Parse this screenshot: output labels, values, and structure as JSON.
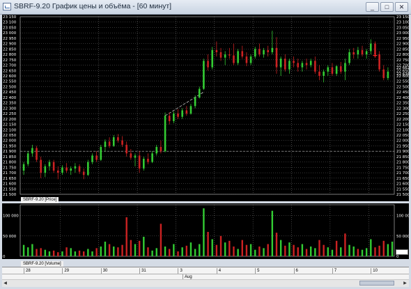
{
  "window": {
    "title": "SBRF-9.20 График цены и объёма - [60 минут]",
    "buttons": [
      "_",
      "□",
      "✕"
    ],
    "icon": "chart-icon"
  },
  "colors": {
    "background": "#000000",
    "up": "#33cc33",
    "down": "#cc2222",
    "grid": "#8a8a8a",
    "marker": "#ff2222"
  },
  "price_pane": {
    "label": "SBRF-9.20 [Price]",
    "y_ticks": [
      "23 150",
      "23 100",
      "23 050",
      "23 000",
      "22 950",
      "22 900",
      "22 850",
      "22 800",
      "22 750",
      "22 700",
      "22 650",
      "22 600",
      "22 550",
      "22 500",
      "22 450",
      "22 400",
      "22 350",
      "22 300",
      "22 250",
      "22 200",
      "22 150",
      "22 100",
      "22 050",
      "22 000",
      "21 950",
      "21 900",
      "21 850",
      "21 800",
      "21 750",
      "21 700",
      "21 650",
      "21 600",
      "21 550",
      "21 500"
    ],
    "right_highlight_labels": [
      "22 662",
      "22 638"
    ]
  },
  "volume_pane": {
    "label": "SBRF-9.20 [Volume]",
    "y_ticks": [
      "100 000",
      "50 000",
      "0"
    ]
  },
  "dates": [
    "28",
    "29",
    "30",
    "31",
    "3",
    "4",
    "5",
    "6",
    "7",
    "10"
  ],
  "month": "Aug",
  "chart_data": [
    {
      "type": "candlestick",
      "title": "SBRF-9.20 [Price]",
      "ylim": [
        21500,
        23150
      ],
      "horizontal_ref_line": 21900,
      "days": [
        "28",
        "29",
        "30",
        "31",
        "3",
        "4",
        "5",
        "6",
        "7",
        "10"
      ],
      "trend_line": {
        "from": [
          2230,
          22230
        ],
        "to": [
          2270,
          22450
        ]
      },
      "candles": [
        {
          "o": 21720,
          "h": 21800,
          "l": 21680,
          "c": 21780
        },
        {
          "o": 21780,
          "h": 21900,
          "l": 21760,
          "c": 21880
        },
        {
          "o": 21880,
          "h": 21960,
          "l": 21850,
          "c": 21930
        },
        {
          "o": 21930,
          "h": 21950,
          "l": 21800,
          "c": 21820
        },
        {
          "o": 21820,
          "h": 21850,
          "l": 21650,
          "c": 21700
        },
        {
          "o": 21700,
          "h": 21780,
          "l": 21660,
          "c": 21760
        },
        {
          "o": 21760,
          "h": 21820,
          "l": 21720,
          "c": 21800
        },
        {
          "o": 21800,
          "h": 21820,
          "l": 21700,
          "c": 21720
        },
        {
          "o": 21720,
          "h": 21760,
          "l": 21640,
          "c": 21700
        },
        {
          "o": 21700,
          "h": 21770,
          "l": 21680,
          "c": 21750
        },
        {
          "o": 21750,
          "h": 21790,
          "l": 21700,
          "c": 21720
        },
        {
          "o": 21720,
          "h": 21760,
          "l": 21680,
          "c": 21740
        },
        {
          "o": 21740,
          "h": 21790,
          "l": 21700,
          "c": 21760
        },
        {
          "o": 21760,
          "h": 21780,
          "l": 21690,
          "c": 21710
        },
        {
          "o": 21710,
          "h": 21740,
          "l": 21640,
          "c": 21680
        },
        {
          "o": 21680,
          "h": 21820,
          "l": 21670,
          "c": 21800
        },
        {
          "o": 21800,
          "h": 21880,
          "l": 21780,
          "c": 21860
        },
        {
          "o": 21860,
          "h": 21900,
          "l": 21800,
          "c": 21820
        },
        {
          "o": 21820,
          "h": 21960,
          "l": 21810,
          "c": 21940
        },
        {
          "o": 21940,
          "h": 22010,
          "l": 21900,
          "c": 21990
        },
        {
          "o": 21990,
          "h": 22030,
          "l": 21930,
          "c": 21950
        },
        {
          "o": 21950,
          "h": 22050,
          "l": 21940,
          "c": 22030
        },
        {
          "o": 22030,
          "h": 22060,
          "l": 21980,
          "c": 22000
        },
        {
          "o": 22000,
          "h": 22040,
          "l": 21940,
          "c": 21960
        },
        {
          "o": 21960,
          "h": 21990,
          "l": 21850,
          "c": 21880
        },
        {
          "o": 21880,
          "h": 21920,
          "l": 21820,
          "c": 21840
        },
        {
          "o": 21840,
          "h": 21880,
          "l": 21760,
          "c": 21860
        },
        {
          "o": 21860,
          "h": 21900,
          "l": 21700,
          "c": 21740
        },
        {
          "o": 21740,
          "h": 21850,
          "l": 21720,
          "c": 21830
        },
        {
          "o": 21830,
          "h": 21880,
          "l": 21780,
          "c": 21800
        },
        {
          "o": 21800,
          "h": 21900,
          "l": 21790,
          "c": 21880
        },
        {
          "o": 21880,
          "h": 21960,
          "l": 21860,
          "c": 21940
        },
        {
          "o": 21940,
          "h": 22000,
          "l": 21880,
          "c": 21900
        },
        {
          "o": 21900,
          "h": 22260,
          "l": 21890,
          "c": 22230
        },
        {
          "o": 22230,
          "h": 22260,
          "l": 22150,
          "c": 22180
        },
        {
          "o": 22180,
          "h": 22270,
          "l": 22160,
          "c": 22250
        },
        {
          "o": 22250,
          "h": 22290,
          "l": 22200,
          "c": 22220
        },
        {
          "o": 22220,
          "h": 22300,
          "l": 22200,
          "c": 22280
        },
        {
          "o": 22280,
          "h": 22320,
          "l": 22230,
          "c": 22250
        },
        {
          "o": 22250,
          "h": 22340,
          "l": 22240,
          "c": 22320
        },
        {
          "o": 22320,
          "h": 22420,
          "l": 22300,
          "c": 22400
        },
        {
          "o": 22400,
          "h": 22500,
          "l": 22390,
          "c": 22480
        },
        {
          "o": 22480,
          "h": 22760,
          "l": 22470,
          "c": 22740
        },
        {
          "o": 22740,
          "h": 22800,
          "l": 22650,
          "c": 22680
        },
        {
          "o": 22680,
          "h": 22870,
          "l": 22660,
          "c": 22840
        },
        {
          "o": 22840,
          "h": 22920,
          "l": 22780,
          "c": 22820
        },
        {
          "o": 22820,
          "h": 22860,
          "l": 22740,
          "c": 22770
        },
        {
          "o": 22770,
          "h": 22830,
          "l": 22700,
          "c": 22800
        },
        {
          "o": 22800,
          "h": 22860,
          "l": 22760,
          "c": 22790
        },
        {
          "o": 22790,
          "h": 22900,
          "l": 22700,
          "c": 22720
        },
        {
          "o": 22720,
          "h": 22850,
          "l": 22700,
          "c": 22830
        },
        {
          "o": 22830,
          "h": 22880,
          "l": 22760,
          "c": 22780
        },
        {
          "o": 22780,
          "h": 22820,
          "l": 22690,
          "c": 22720
        },
        {
          "o": 22720,
          "h": 22800,
          "l": 22700,
          "c": 22780
        },
        {
          "o": 22780,
          "h": 22870,
          "l": 22760,
          "c": 22850
        },
        {
          "o": 22850,
          "h": 22900,
          "l": 22780,
          "c": 22800
        },
        {
          "o": 22800,
          "h": 22860,
          "l": 22770,
          "c": 22840
        },
        {
          "o": 22840,
          "h": 22880,
          "l": 22780,
          "c": 22820
        },
        {
          "o": 22820,
          "h": 23020,
          "l": 22800,
          "c": 22860
        },
        {
          "o": 22860,
          "h": 22960,
          "l": 22620,
          "c": 22680
        },
        {
          "o": 22680,
          "h": 22780,
          "l": 22600,
          "c": 22760
        },
        {
          "o": 22760,
          "h": 22800,
          "l": 22640,
          "c": 22660
        },
        {
          "o": 22660,
          "h": 22760,
          "l": 22620,
          "c": 22740
        },
        {
          "o": 22740,
          "h": 22780,
          "l": 22680,
          "c": 22720
        },
        {
          "o": 22720,
          "h": 22760,
          "l": 22640,
          "c": 22680
        },
        {
          "o": 22680,
          "h": 22740,
          "l": 22640,
          "c": 22720
        },
        {
          "o": 22720,
          "h": 22760,
          "l": 22660,
          "c": 22700
        },
        {
          "o": 22700,
          "h": 22760,
          "l": 22680,
          "c": 22740
        },
        {
          "o": 22740,
          "h": 22780,
          "l": 22620,
          "c": 22640
        },
        {
          "o": 22640,
          "h": 22700,
          "l": 22560,
          "c": 22600
        },
        {
          "o": 22600,
          "h": 22660,
          "l": 22540,
          "c": 22640
        },
        {
          "o": 22640,
          "h": 22700,
          "l": 22600,
          "c": 22680
        },
        {
          "o": 22680,
          "h": 22720,
          "l": 22600,
          "c": 22620
        },
        {
          "o": 22620,
          "h": 22700,
          "l": 22600,
          "c": 22690
        },
        {
          "o": 22690,
          "h": 22730,
          "l": 22620,
          "c": 22640
        },
        {
          "o": 22640,
          "h": 22760,
          "l": 22560,
          "c": 22720
        },
        {
          "o": 22720,
          "h": 22850,
          "l": 22700,
          "c": 22820
        },
        {
          "o": 22820,
          "h": 22860,
          "l": 22760,
          "c": 22800
        },
        {
          "o": 22800,
          "h": 22870,
          "l": 22760,
          "c": 22840
        },
        {
          "o": 22840,
          "h": 22880,
          "l": 22780,
          "c": 22800
        },
        {
          "o": 22800,
          "h": 22850,
          "l": 22760,
          "c": 22830
        },
        {
          "o": 22830,
          "h": 22940,
          "l": 22800,
          "c": 22900
        },
        {
          "o": 22900,
          "h": 22920,
          "l": 22780,
          "c": 22800
        },
        {
          "o": 22800,
          "h": 22830,
          "l": 22640,
          "c": 22660
        },
        {
          "o": 22660,
          "h": 22700,
          "l": 22560,
          "c": 22580
        },
        {
          "o": 22580,
          "h": 22680,
          "l": 22560,
          "c": 22640
        }
      ]
    },
    {
      "type": "bar",
      "title": "SBRF-9.20 [Volume]",
      "ylim": [
        0,
        120000
      ],
      "values": [
        28000,
        22000,
        30000,
        18000,
        20000,
        16000,
        12000,
        14000,
        10000,
        12000,
        22000,
        20000,
        12000,
        14000,
        12000,
        18000,
        12000,
        20000,
        24000,
        36000,
        30000,
        24000,
        22000,
        28000,
        96000,
        40000,
        30000,
        38000,
        48000,
        22000,
        14000,
        20000,
        80000,
        24000,
        18000,
        30000,
        12000,
        22000,
        26000,
        34000,
        18000,
        30000,
        118000,
        60000,
        42000,
        28000,
        50000,
        34000,
        38000,
        24000,
        18000,
        40000,
        28000,
        30000,
        16000,
        24000,
        20000,
        30000,
        112000,
        58000,
        40000,
        26000,
        34000,
        28000,
        22000,
        30000,
        18000,
        24000,
        20000,
        40000,
        28000,
        22000,
        16000,
        38000,
        22000,
        56000,
        28000,
        24000,
        18000,
        16000,
        20000,
        42000,
        22000,
        26000,
        38000,
        30000,
        36000
      ],
      "directions": [
        "u",
        "u",
        "u",
        "d",
        "d",
        "u",
        "u",
        "d",
        "d",
        "u",
        "d",
        "u",
        "u",
        "d",
        "d",
        "u",
        "u",
        "d",
        "u",
        "u",
        "d",
        "u",
        "d",
        "d",
        "d",
        "d",
        "u",
        "d",
        "u",
        "d",
        "u",
        "u",
        "d",
        "u",
        "d",
        "u",
        "d",
        "u",
        "d",
        "u",
        "u",
        "u",
        "u",
        "d",
        "u",
        "d",
        "d",
        "u",
        "d",
        "d",
        "u",
        "d",
        "d",
        "u",
        "u",
        "d",
        "u",
        "d",
        "u",
        "d",
        "u",
        "d",
        "u",
        "d",
        "d",
        "u",
        "d",
        "u",
        "u",
        "d",
        "d",
        "u",
        "u",
        "d",
        "u",
        "d",
        "u",
        "u",
        "d",
        "u",
        "u",
        "u",
        "d",
        "d",
        "d",
        "u",
        "u"
      ]
    }
  ]
}
